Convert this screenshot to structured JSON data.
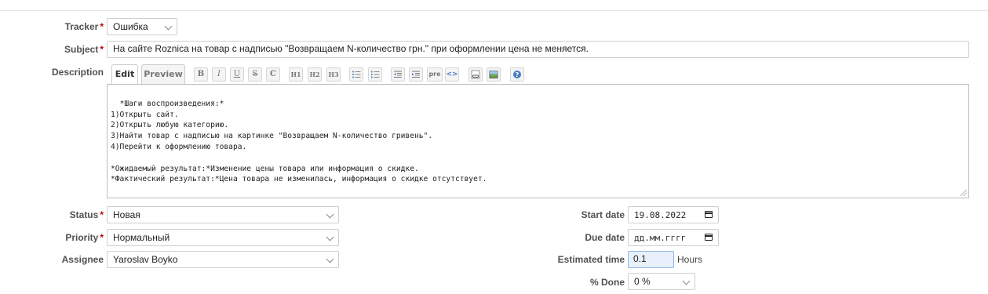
{
  "form": {
    "tracker": {
      "label": "Tracker",
      "value": "Ошибка"
    },
    "subject": {
      "label": "Subject",
      "value": "На сайте Roznica на товар с надписью \"Возвращаем N-количество грн.\" при оформлении цена не меняется."
    },
    "description": {
      "label": "Description",
      "tabs": [
        "Edit",
        "Preview"
      ],
      "toolbar": [
        "B",
        "I",
        "U",
        "S",
        "C",
        "H1",
        "H2",
        "H3",
        "ul",
        "ol",
        "indent-left",
        "indent-right",
        "pre",
        "<>",
        "link",
        "image",
        "?"
      ],
      "text": "*Шаги воспроизведения:*\n1)Открыть сайт.\n2)Открыть любую категорию.\n3)Найти товар с надписью на картинке \"Возвращаем N-количество гривень\".\n4)Перейти к оформлению товара.\n\n*Ожидаемый результат:*Изменение цены товара или информация о скидке.\n*Фактический результат:*Цена товара не изменилась, информация о скидке отсутствует."
    },
    "status": {
      "label": "Status",
      "value": "Новая"
    },
    "priority": {
      "label": "Priority",
      "value": "Нормальный"
    },
    "assignee": {
      "label": "Assignee",
      "value": "Yaroslav Boyko"
    },
    "start_date": {
      "label": "Start date",
      "value": "19.08.2022"
    },
    "due_date": {
      "label": "Due date",
      "value": "дд.мм.гггг"
    },
    "estimated_time": {
      "label": "Estimated time",
      "value": "0.1",
      "unit": "Hours"
    },
    "done": {
      "label": "% Done",
      "value": "0 %"
    }
  }
}
